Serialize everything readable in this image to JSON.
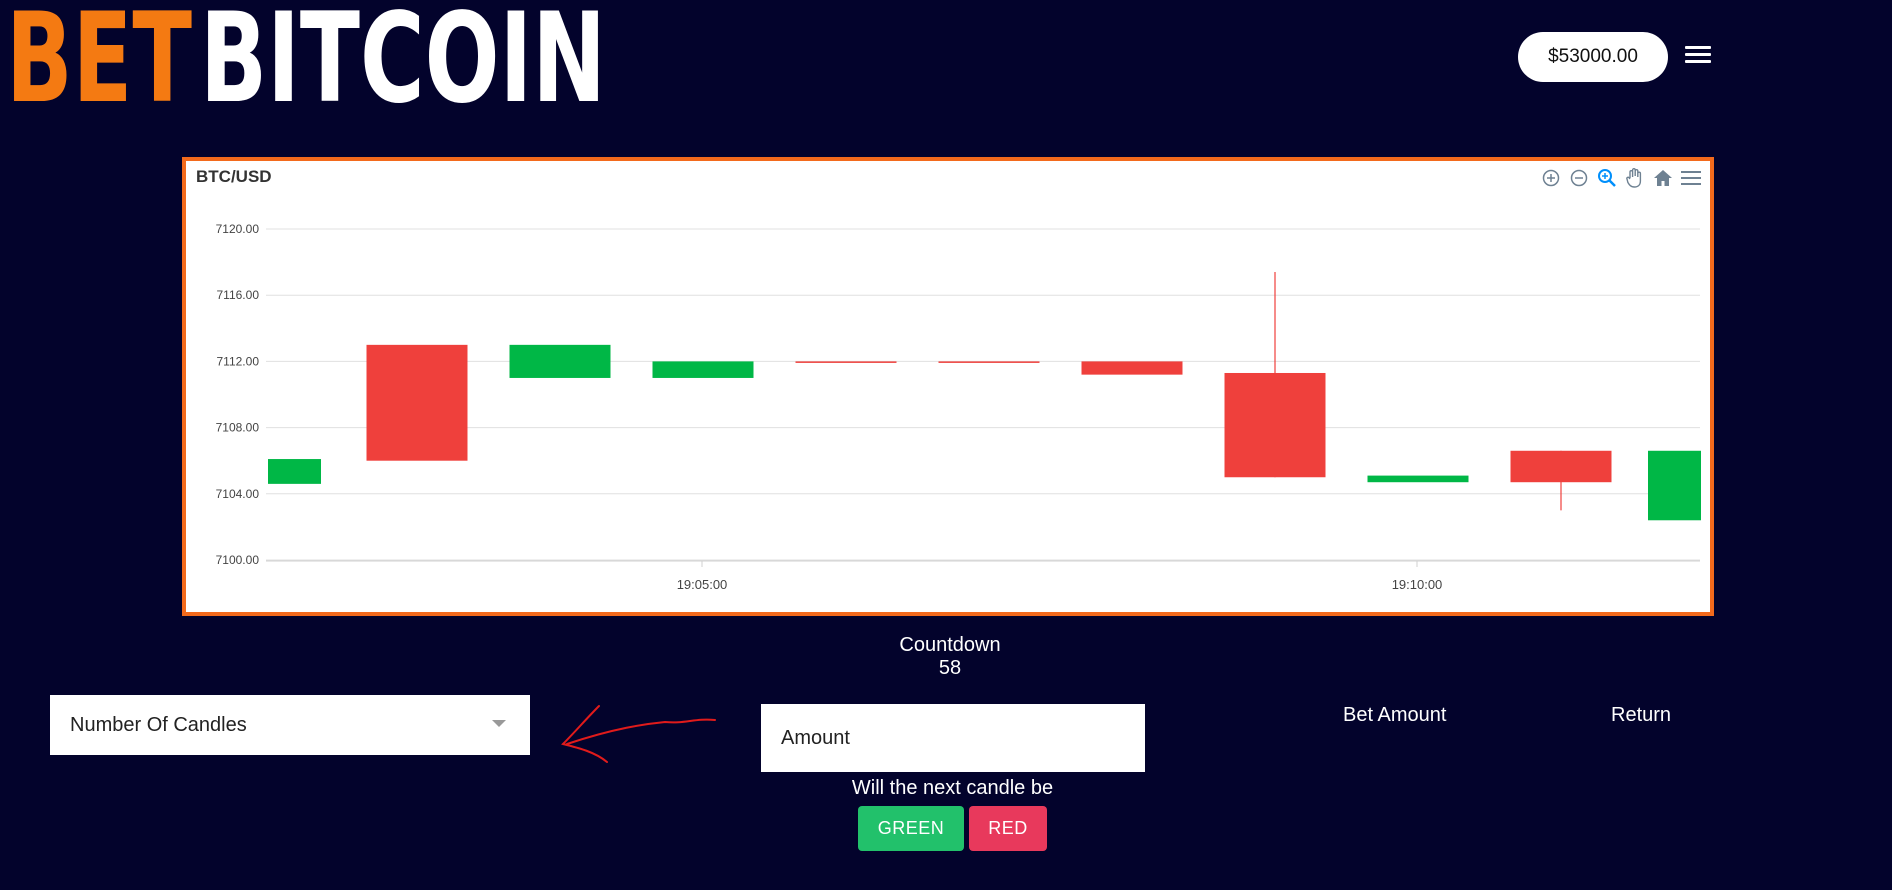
{
  "header": {
    "logo_text": "BETBITCOIN",
    "logo_part1": "BET",
    "logo_part2": "BITCOIN",
    "balance": "$53000.00"
  },
  "chart": {
    "title": "BTC/USD",
    "toolbar_icons": [
      "zoom-in-icon",
      "zoom-out-icon",
      "zoom-selection-icon",
      "pan-hand-icon",
      "home-reset-icon",
      "menu-icon"
    ]
  },
  "chart_data": {
    "type": "candlestick",
    "title": "BTC/USD",
    "xlabel": "",
    "ylabel": "",
    "ylim": [
      7100,
      7120
    ],
    "y_ticks": [
      "7120.00",
      "7116.00",
      "7112.00",
      "7108.00",
      "7104.00",
      "7100.00"
    ],
    "x_tick_labels": [
      "19:05:00",
      "19:10:00"
    ],
    "grid": true,
    "candles": [
      {
        "o": 7104.6,
        "h": 7106.1,
        "l": 7104.6,
        "c": 7106.1,
        "color": "green"
      },
      {
        "o": 7113.0,
        "h": 7113.0,
        "l": 7106.0,
        "c": 7106.0,
        "color": "red"
      },
      {
        "o": 7111.0,
        "h": 7113.0,
        "l": 7111.0,
        "c": 7113.0,
        "color": "green"
      },
      {
        "o": 7111.0,
        "h": 7112.0,
        "l": 7111.0,
        "c": 7112.0,
        "color": "green"
      },
      {
        "o": 7112.0,
        "h": 7112.0,
        "l": 7112.0,
        "c": 7112.0,
        "color": "red"
      },
      {
        "o": 7112.0,
        "h": 7112.0,
        "l": 7112.0,
        "c": 7112.0,
        "color": "red"
      },
      {
        "o": 7112.0,
        "h": 7112.0,
        "l": 7111.2,
        "c": 7111.2,
        "color": "red"
      },
      {
        "o": 7111.3,
        "h": 7117.4,
        "l": 7105.0,
        "c": 7105.0,
        "color": "red"
      },
      {
        "o": 7104.7,
        "h": 7105.1,
        "l": 7104.7,
        "c": 7105.1,
        "color": "green"
      },
      {
        "o": 7106.6,
        "h": 7106.6,
        "l": 7103.0,
        "c": 7104.7,
        "color": "red"
      },
      {
        "o": 7102.4,
        "h": 7106.6,
        "l": 7102.4,
        "c": 7106.6,
        "color": "green"
      }
    ],
    "colors": {
      "up": "#00b746",
      "down": "#ef403c"
    }
  },
  "countdown": {
    "label": "Countdown",
    "value": "58"
  },
  "controls": {
    "candles_select_label": "Number Of Candles",
    "amount_placeholder": "Amount",
    "bet_amount_header": "Bet Amount",
    "return_header": "Return",
    "question": "Will the next candle be",
    "green_button": "GREEN",
    "red_button": "RED"
  }
}
